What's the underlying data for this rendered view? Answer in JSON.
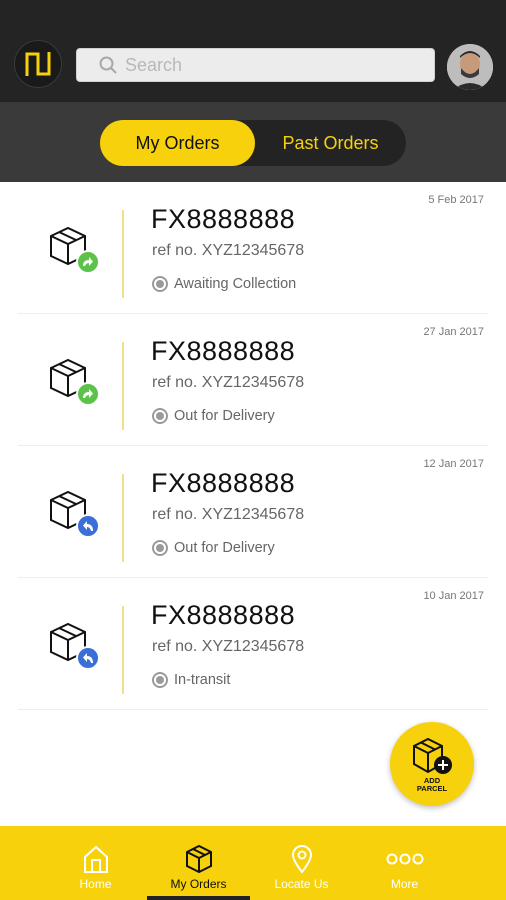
{
  "header": {
    "search_placeholder": "Search"
  },
  "tabs": [
    {
      "label": "My Orders",
      "active": true
    },
    {
      "label": "Past Orders",
      "active": false
    }
  ],
  "orders": [
    {
      "code": "FX8888888",
      "ref": "ref no. XYZ12345678",
      "status": "Awaiting Collection",
      "date": "5 Feb 2017",
      "badge": "green-forward-arrow-icon"
    },
    {
      "code": "FX8888888",
      "ref": "ref no. XYZ12345678",
      "status": "Out for Delivery",
      "date": "27 Jan 2017",
      "badge": "green-forward-arrow-icon"
    },
    {
      "code": "FX8888888",
      "ref": "ref no. XYZ12345678",
      "status": "Out for Delivery",
      "date": "12 Jan 2017",
      "badge": "blue-return-arrow-icon"
    },
    {
      "code": "FX8888888",
      "ref": "ref no. XYZ12345678",
      "status": "In-transit",
      "date": "10 Jan 2017",
      "badge": "blue-return-arrow-icon"
    }
  ],
  "fab": {
    "label": "ADD PARCEL"
  },
  "bottom_nav": [
    {
      "label": "Home",
      "icon": "home-icon"
    },
    {
      "label": "My Orders",
      "icon": "package-icon",
      "active": true
    },
    {
      "label": "Locate Us",
      "icon": "map-pin-icon"
    },
    {
      "label": "More",
      "icon": "more-dots-icon"
    }
  ],
  "colors": {
    "accent": "#f6d10c",
    "header_bg": "#242424",
    "tabbar_bg": "#3a3a3a",
    "green_badge": "#5cc24a",
    "blue_badge": "#3a6fd8"
  }
}
